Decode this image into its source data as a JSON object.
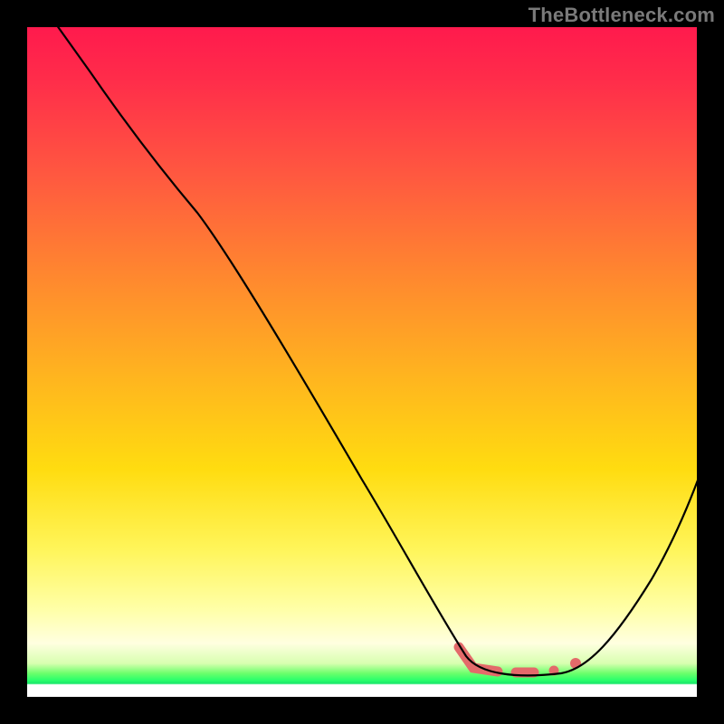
{
  "watermark": "TheBottleneck.com",
  "colors": {
    "curve": "#000000",
    "highlight": "#e36a6a",
    "frame": "#000000"
  },
  "chart_data": {
    "type": "line",
    "title": "",
    "xlabel": "",
    "ylabel": "",
    "xlim": [
      0,
      100
    ],
    "ylim": [
      0,
      100
    ],
    "grid": false,
    "legend": false,
    "series": [
      {
        "name": "bottleneck-curve",
        "x": [
          3,
          10,
          20,
          26,
          35,
          45,
          55,
          62,
          65,
          68,
          72,
          76,
          80,
          83,
          86,
          90,
          95,
          100
        ],
        "y": [
          100,
          90,
          78,
          70,
          55,
          38,
          22,
          11,
          7,
          4,
          2,
          1.5,
          1.5,
          2,
          5,
          12,
          24,
          38
        ]
      }
    ],
    "highlight_region": {
      "name": "valley-low-bottleneck",
      "x": [
        64,
        80
      ],
      "y_approx": 2,
      "style": "thick-salmon"
    },
    "annotations": []
  }
}
